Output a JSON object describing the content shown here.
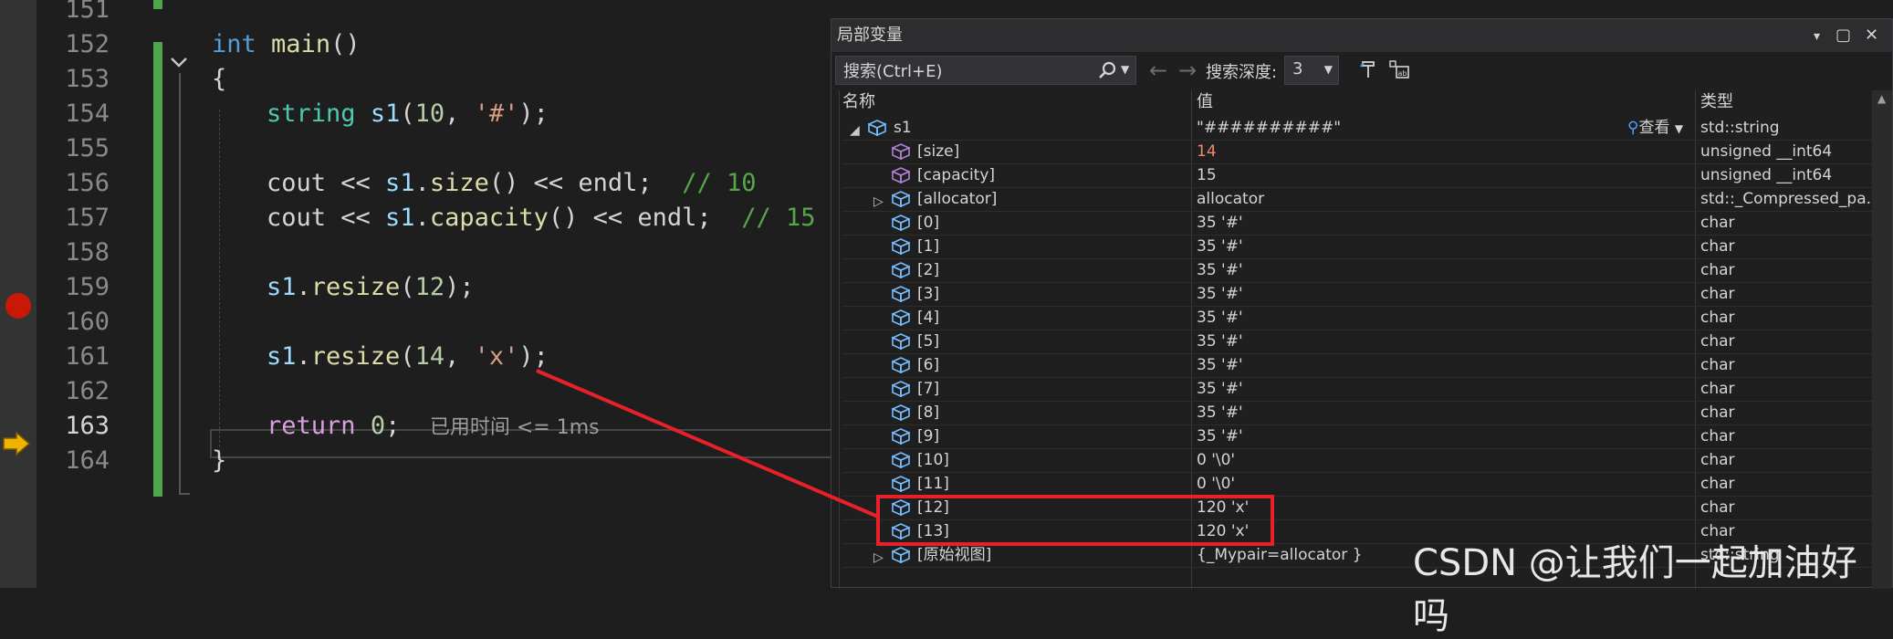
{
  "editor": {
    "line_numbers": [
      "151",
      "152",
      "153",
      "154",
      "155",
      "156",
      "157",
      "158",
      "159",
      "160",
      "161",
      "162",
      "163",
      "164"
    ],
    "lines": {
      "l152": {
        "kw": "int",
        "fn": "main",
        "rest": "()"
      },
      "l153": "{",
      "l154": {
        "type": "string",
        "var": "s1",
        "p1": "(",
        "n": "10",
        "p2": ", ",
        "s": "'#'",
        "p3": ");"
      },
      "l156": {
        "a": "cout << ",
        "var": "s1",
        "b": ".",
        "fn": "size",
        "c": "() << endl;  ",
        "cmt": "// 10"
      },
      "l157": {
        "a": "cout << ",
        "var": "s1",
        "b": ".",
        "fn": "capacity",
        "c": "() << endl;  ",
        "cmt": "// 15"
      },
      "l159": {
        "var": "s1",
        "b": ".",
        "fn": "resize",
        "p1": "(",
        "n": "12",
        "p3": ");"
      },
      "l161": {
        "var": "s1",
        "b": ".",
        "fn": "resize",
        "p1": "(",
        "n": "14",
        "p2": ", ",
        "s": "'x'",
        "p3": ");"
      },
      "l163": {
        "kw": "return",
        "sp": " ",
        "n": "0",
        "semi": ";",
        "hint": "已用时间 <= 1ms"
      },
      "l164": "}"
    }
  },
  "locals": {
    "title": "局部变量",
    "title_buttons": {
      "dropdown": "▾",
      "maximize": "▢",
      "close": "✕"
    },
    "search_placeholder": "搜索(Ctrl+E)",
    "nav_back": "←",
    "nav_forward": "→",
    "depth_label": "搜索深度:",
    "depth_value": "3",
    "columns": {
      "name": "名称",
      "value": "值",
      "type": "类型"
    },
    "view_label": "查看",
    "rows": [
      {
        "name": "s1",
        "value": "\"##########\"",
        "type": "std::string"
      },
      {
        "name": "[size]",
        "value": "14",
        "type": "unsigned __int64"
      },
      {
        "name": "[capacity]",
        "value": "15",
        "type": "unsigned __int64"
      },
      {
        "name": "[allocator]",
        "value": "allocator",
        "type": "std::_Compressed_pa..."
      },
      {
        "name": "[0]",
        "value": "35 '#'",
        "type": "char"
      },
      {
        "name": "[1]",
        "value": "35 '#'",
        "type": "char"
      },
      {
        "name": "[2]",
        "value": "35 '#'",
        "type": "char"
      },
      {
        "name": "[3]",
        "value": "35 '#'",
        "type": "char"
      },
      {
        "name": "[4]",
        "value": "35 '#'",
        "type": "char"
      },
      {
        "name": "[5]",
        "value": "35 '#'",
        "type": "char"
      },
      {
        "name": "[6]",
        "value": "35 '#'",
        "type": "char"
      },
      {
        "name": "[7]",
        "value": "35 '#'",
        "type": "char"
      },
      {
        "name": "[8]",
        "value": "35 '#'",
        "type": "char"
      },
      {
        "name": "[9]",
        "value": "35 '#'",
        "type": "char"
      },
      {
        "name": "[10]",
        "value": "0 '\\0'",
        "type": "char"
      },
      {
        "name": "[11]",
        "value": "0 '\\0'",
        "type": "char"
      },
      {
        "name": "[12]",
        "value": "120 'x'",
        "type": "char"
      },
      {
        "name": "[13]",
        "value": "120 'x'",
        "type": "char"
      },
      {
        "name": "[原始视图]",
        "value": "{_Mypair=allocator }",
        "type": "std::string"
      }
    ]
  },
  "watermark": "CSDN @让我们一起加油好吗",
  "colors": {
    "highlight": "#e8202a",
    "breakpoint": "#e51400",
    "green_bar": "#4ea64a",
    "changed_value": "#f48771"
  }
}
